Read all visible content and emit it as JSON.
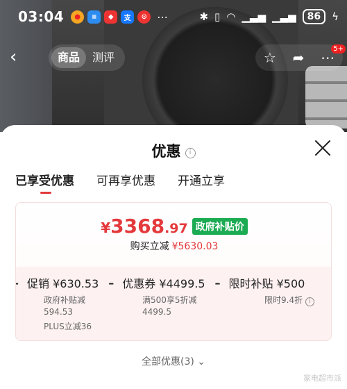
{
  "status_bar": {
    "time": "03:04",
    "notif_icons": [
      "weibo-icon",
      "news-icon",
      "toutiao-icon",
      "alipay-icon",
      "app-icon"
    ],
    "battery": "86"
  },
  "nav": {
    "back": "‹",
    "tabs": [
      {
        "label": "商品"
      },
      {
        "label": "测评"
      }
    ],
    "cart_badge": "5+"
  },
  "sheet": {
    "title": "优惠",
    "info_icon": "i",
    "tabs": [
      {
        "label": "已享受优惠"
      },
      {
        "label": "可再享优惠"
      },
      {
        "label": "开通立享"
      }
    ],
    "price": {
      "symbol": "¥",
      "integer": "3368",
      "decimal": ".97"
    },
    "price_tag": "政府补贴价",
    "buy_prefix": "购买立减",
    "buy_amount": "¥5630.03",
    "promos": [
      {
        "label": "促销 ¥630.53",
        "sub": [
          "政府补贴减",
          "594.53",
          "PLUS立减36"
        ]
      },
      {
        "label": "优惠券 ¥4499.5",
        "sub": [
          "满500享5折减",
          "4499.5"
        ]
      },
      {
        "label": "限时补贴 ¥500",
        "sub": [
          "限时9.4折"
        ]
      }
    ],
    "all_offers": "全部优惠(3)",
    "watermark": "家电超市派"
  },
  "colors": {
    "accent": "#e4393c",
    "gov_green": "#1bab52"
  }
}
